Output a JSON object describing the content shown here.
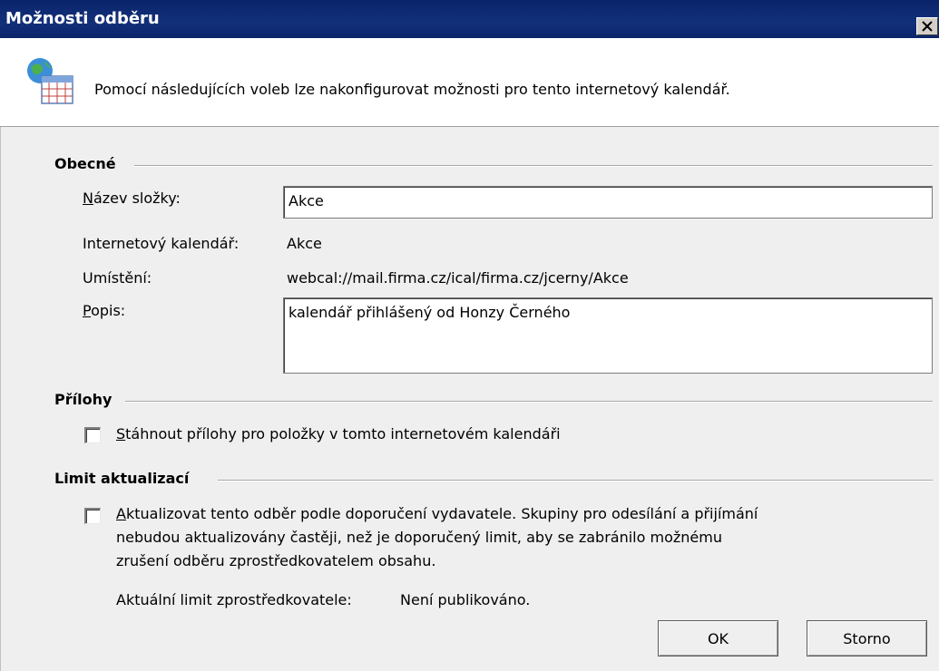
{
  "window": {
    "title": "Možnosti odběru",
    "close_glyph": "✕"
  },
  "header": {
    "icon": "calendar-globe-icon",
    "description": "Pomocí následujících voleb lze nakonfigurovat možnosti pro tento internetový kalendář."
  },
  "general": {
    "heading": "Obecné",
    "folder_name": {
      "access_key": "N",
      "label_rest": "ázev složky:",
      "value": "Akce"
    },
    "internet_calendar": {
      "label": "Internetový kalendář:",
      "value": "Akce"
    },
    "location": {
      "label": "Umístění:",
      "value": "webcal://mail.firma.cz/ical/firma.cz/jcerny/Akce"
    },
    "description": {
      "access_key": "P",
      "label_rest": "opis:",
      "value": "kalendář přihlášený od Honzy Černého"
    }
  },
  "attachments": {
    "heading": "Přílohy",
    "download": {
      "checked": false,
      "access_key": "S",
      "label_rest": "táhnout přílohy pro položky v tomto internetovém kalendáři"
    }
  },
  "update_limit": {
    "heading": "Limit aktualizací",
    "publisher_recommendation": {
      "checked": false,
      "access_key": "A",
      "line1_rest": "ktualizovat tento odběr podle doporučení vydavatele. Skupiny pro odesílání a přijímání",
      "line2": "nebudou aktualizovány častěji, než je doporučený limit, aby se zabránilo možnému",
      "line3": "zrušení odběru zprostředkovatelem obsahu."
    },
    "current_limit": {
      "label": "Aktuální limit zprostředkovatele:",
      "value": "Není publikováno."
    }
  },
  "buttons": {
    "ok": "OK",
    "cancel": "Storno"
  },
  "colors": {
    "titlebar": "#0a246a",
    "dialog_bg": "#efefef",
    "header_bg": "#ffffff"
  }
}
